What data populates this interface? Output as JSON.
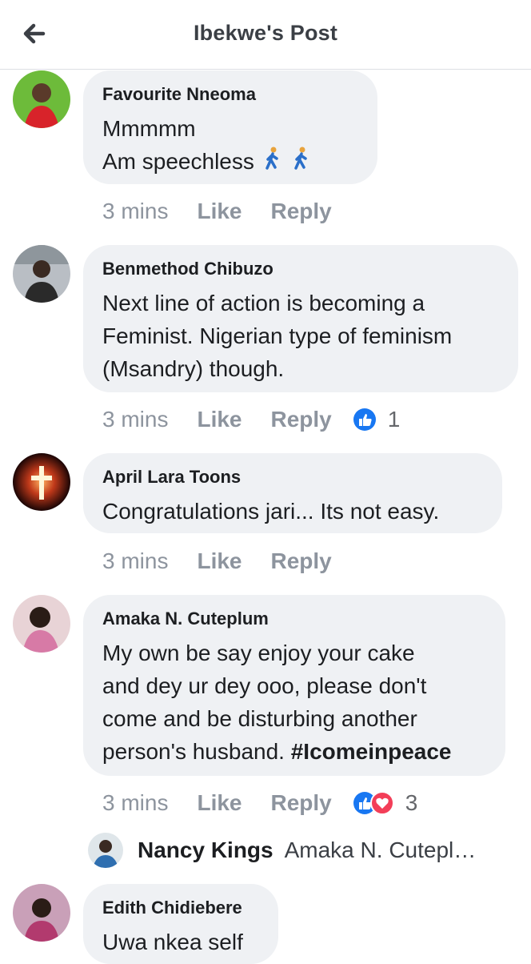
{
  "header": {
    "title": "Ibekwe's Post",
    "back_icon": "back-arrow-icon"
  },
  "comments": [
    {
      "author": "Favourite Nneoma",
      "lines": [
        "Mmmmm",
        "Am speechless"
      ],
      "time": "3 mins",
      "like": "Like",
      "reply": "Reply",
      "reaction_count": ""
    },
    {
      "author": "Benmethod Chibuzo",
      "lines": [
        "Next line of action is becoming a",
        "Feminist. Nigerian type of feminism",
        "(Msandry) though."
      ],
      "time": "3 mins",
      "like": "Like",
      "reply": "Reply",
      "reaction_count": "1"
    },
    {
      "author": "April Lara Toons",
      "lines": [
        "Congratulations jari... Its not easy."
      ],
      "time": "3 mins",
      "like": "Like",
      "reply": "Reply",
      "reaction_count": ""
    },
    {
      "author": "Amaka N. Cuteplum",
      "lines": [
        "My  own be say enjoy your cake",
        "and dey ur dey ooo, please don't",
        "come and be disturbing another"
      ],
      "last_line_text": "person's husband. ",
      "hashtag": "#Icomeinpeace",
      "time": "3 mins",
      "like": "Like",
      "reply": "Reply",
      "reaction_count": "3"
    },
    {
      "author": "Edith Chidiebere",
      "lines": [
        "Uwa nkea self"
      ]
    }
  ],
  "reply_preview": {
    "author": "Nancy Kings",
    "text": "Amaka N. Cutepl…"
  },
  "colors": {
    "bubble": "#eff1f4",
    "meta": "#8d949e",
    "like_blue": "#1877f2",
    "love_red": "#f33e58"
  }
}
